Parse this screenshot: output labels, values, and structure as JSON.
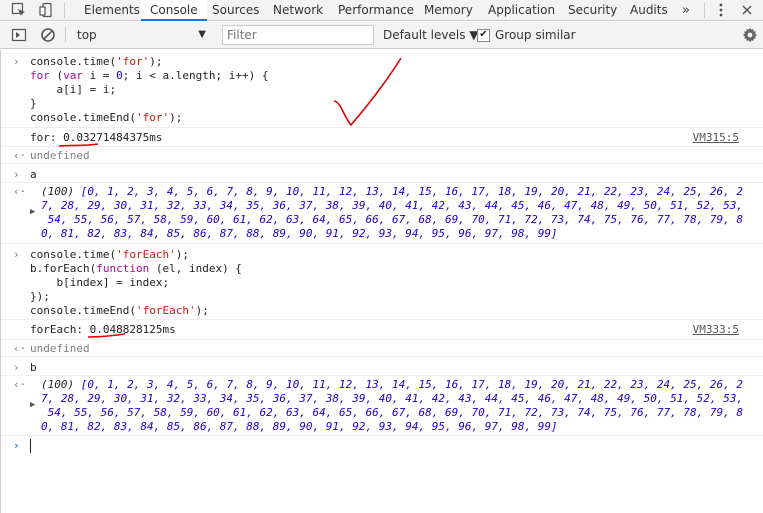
{
  "tabs": [
    {
      "label": "Elements"
    },
    {
      "label": "Console",
      "active": true
    },
    {
      "label": "Sources"
    },
    {
      "label": "Network"
    },
    {
      "label": "Performance"
    },
    {
      "label": "Memory"
    },
    {
      "label": "Application"
    },
    {
      "label": "Security"
    },
    {
      "label": "Audits"
    }
  ],
  "toolbar": {
    "context": "top",
    "filter_placeholder": "Filter",
    "levels": "Default levels ▼",
    "group_similar": "Group similar",
    "group_checked": true
  },
  "entries": {
    "in1": [
      "console.time('for');",
      "for (var i = 0; i < a.length; i++) {",
      "    a[i] = i;",
      "}",
      "console.timeEnd('for');"
    ],
    "out1": {
      "text": "for: 0.03271484375ms",
      "source": "VM315:5"
    },
    "ret1": "undefined",
    "in2": "a",
    "arr1": {
      "count": "(100)",
      "l1": "[0, 1, 2, 3, 4, 5, 6, 7, 8, 9, 10, 11, 12, 13, 14, 15, 16, 17, 18, 19, 20, 21, 22, 23, 24, 25, 26, 2",
      "l2": "7, 28, 29, 30, 31, 32, 33, 34, 35, 36, 37, 38, 39, 40, 41, 42, 43, 44, 45, 46, 47, 48, 49, 50, 51, 52, 53,",
      "l3": " 54, 55, 56, 57, 58, 59, 60, 61, 62, 63, 64, 65, 66, 67, 68, 69, 70, 71, 72, 73, 74, 75, 76, 77, 78, 79, 8",
      "l4": "0, 81, 82, 83, 84, 85, 86, 87, 88, 89, 90, 91, 92, 93, 94, 95, 96, 97, 98, 99]"
    },
    "in3": [
      "console.time('forEach');",
      "b.forEach(function (el, index) {",
      "    b[index] = index;",
      "});",
      "console.timeEnd('forEach');"
    ],
    "out2": {
      "text": "forEach: 0.048828125ms",
      "source": "VM333:5"
    },
    "ret2": "undefined",
    "in4": "b",
    "arr2": {
      "count": "(100)",
      "l1": "[0, 1, 2, 3, 4, 5, 6, 7, 8, 9, 10, 11, 12, 13, 14, 15, 16, 17, 18, 19, 20, 21, 22, 23, 24, 25, 26, 2",
      "l2": "7, 28, 29, 30, 31, 32, 33, 34, 35, 36, 37, 38, 39, 40, 41, 42, 43, 44, 45, 46, 47, 48, 49, 50, 51, 52, 53,",
      "l3": " 54, 55, 56, 57, 58, 59, 60, 61, 62, 63, 64, 65, 66, 67, 68, 69, 70, 71, 72, 73, 74, 75, 76, 77, 78, 79, 8",
      "l4": "0, 81, 82, 83, 84, 85, 86, 87, 88, 89, 90, 91, 92, 93, 94, 95, 96, 97, 98, 99]"
    }
  },
  "colors": {
    "accent": "#1a73e8",
    "annotation": "#e00000"
  }
}
